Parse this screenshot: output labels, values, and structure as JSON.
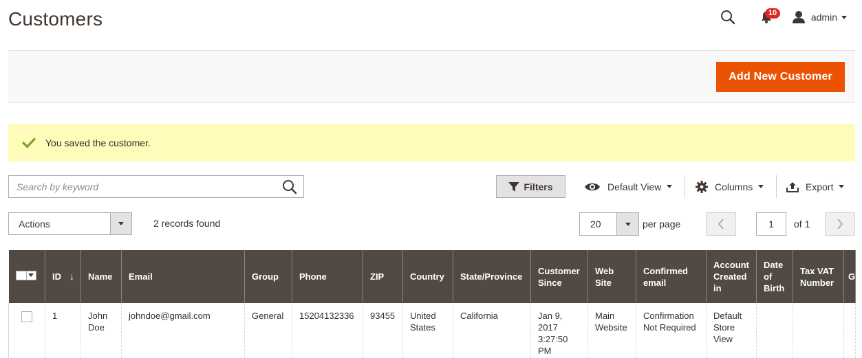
{
  "page": {
    "title": "Customers"
  },
  "header": {
    "notifications_count": "10",
    "user_name": "admin"
  },
  "action_bar": {
    "add_button_label": "Add New Customer"
  },
  "message": {
    "text": "You saved the customer.",
    "type": "success"
  },
  "search": {
    "placeholder": "Search by keyword"
  },
  "toolbar": {
    "filters_label": "Filters",
    "view_label": "Default View",
    "columns_label": "Columns",
    "export_label": "Export"
  },
  "mass_actions": {
    "selected": "Actions"
  },
  "records": {
    "text": "2 records found"
  },
  "pagination": {
    "per_page_value": "20",
    "per_page_label": "per page",
    "current_page": "1",
    "of_label": "of 1"
  },
  "grid": {
    "columns": [
      "ID",
      "Name",
      "Email",
      "Group",
      "Phone",
      "ZIP",
      "Country",
      "State/Province",
      "Customer Since",
      "Web Site",
      "Confirmed email",
      "Account Created in",
      "Date of Birth",
      "Tax VAT Number",
      "G"
    ],
    "sort_indicator": "↓",
    "rows": [
      {
        "id": "1",
        "name": "John Doe",
        "email": "johndoe@gmail.com",
        "group": "General",
        "phone": "15204132336",
        "zip": "93455",
        "country": "United States",
        "state": "California",
        "customer_since": "Jan 9, 2017 3:27:50 PM",
        "web_site": "Main Website",
        "confirmed_email": "Confirmation Not Required",
        "account_created_in": "Default Store View",
        "date_of_birth": "",
        "tax_vat": "",
        "g": ""
      }
    ]
  },
  "colors": {
    "accent": "#eb5202",
    "grid_header": "#514943",
    "message_bg": "#fffbbb",
    "success_check": "#79a22e",
    "badge": "#e22626"
  }
}
